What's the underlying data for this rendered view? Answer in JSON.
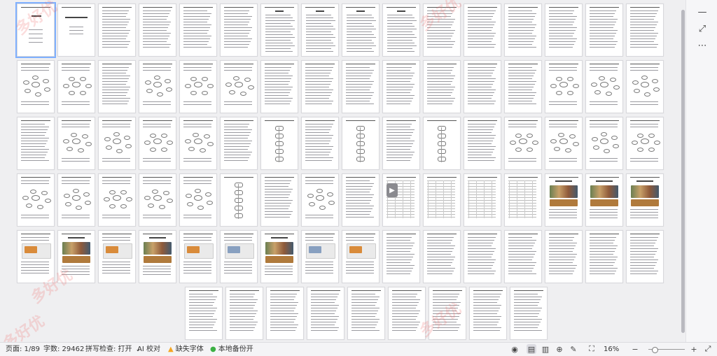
{
  "document": {
    "page_count": 89,
    "current_page": 1,
    "layout": {
      "rows": [
        {
          "count": 16,
          "kinds": [
            "cover",
            "title",
            "text",
            "text",
            "text",
            "text",
            "toc",
            "toc",
            "toc",
            "toc",
            "text",
            "text",
            "text",
            "text",
            "text",
            "text"
          ]
        },
        {
          "count": 16,
          "kinds": [
            "diagram",
            "diagram",
            "text",
            "diagram",
            "diagram",
            "diagram",
            "text",
            "text",
            "text",
            "text",
            "text",
            "text",
            "text",
            "diagram",
            "diagram",
            "diagram"
          ]
        },
        {
          "count": 16,
          "kinds": [
            "text",
            "diagram",
            "diagram",
            "diagram",
            "diagram",
            "text",
            "flow",
            "text",
            "flow",
            "text",
            "flow",
            "text",
            "diagram",
            "diagram",
            "diagram",
            "diagram"
          ]
        },
        {
          "count": 16,
          "kinds": [
            "diagram",
            "diagram",
            "diagram",
            "diagram",
            "diagram",
            "flow",
            "text",
            "diagram",
            "text",
            "table",
            "table",
            "table",
            "table",
            "photo",
            "photo",
            "photo"
          ]
        },
        {
          "count": 16,
          "kinds": [
            "screen",
            "photo",
            "screen",
            "photo",
            "screen",
            "screen",
            "photo",
            "screen",
            "screen",
            "text",
            "text",
            "text",
            "text",
            "text",
            "text",
            "text"
          ]
        },
        {
          "count": 9,
          "kinds": [
            "text",
            "text",
            "text",
            "text",
            "text",
            "text",
            "text",
            "text",
            "text"
          ]
        }
      ]
    }
  },
  "right_rail": {
    "icons": [
      "minus-icon",
      "expand-icon",
      "more-icon"
    ]
  },
  "status": {
    "page_label": "页面: 1/89",
    "words_label": "字数: 29462",
    "spell_label": "拼写检查: 打开",
    "ai_label": "AI 校对",
    "missing_font_label": "缺失字体",
    "backup_label": "本地备份开",
    "zoom_label": "16%",
    "zoom_value_percent": 16
  },
  "watermark": {
    "text": "多好优"
  },
  "colors": {
    "warning": "#f5a623",
    "backup_ok": "#3cb043",
    "selection": "#7fb0ff"
  }
}
